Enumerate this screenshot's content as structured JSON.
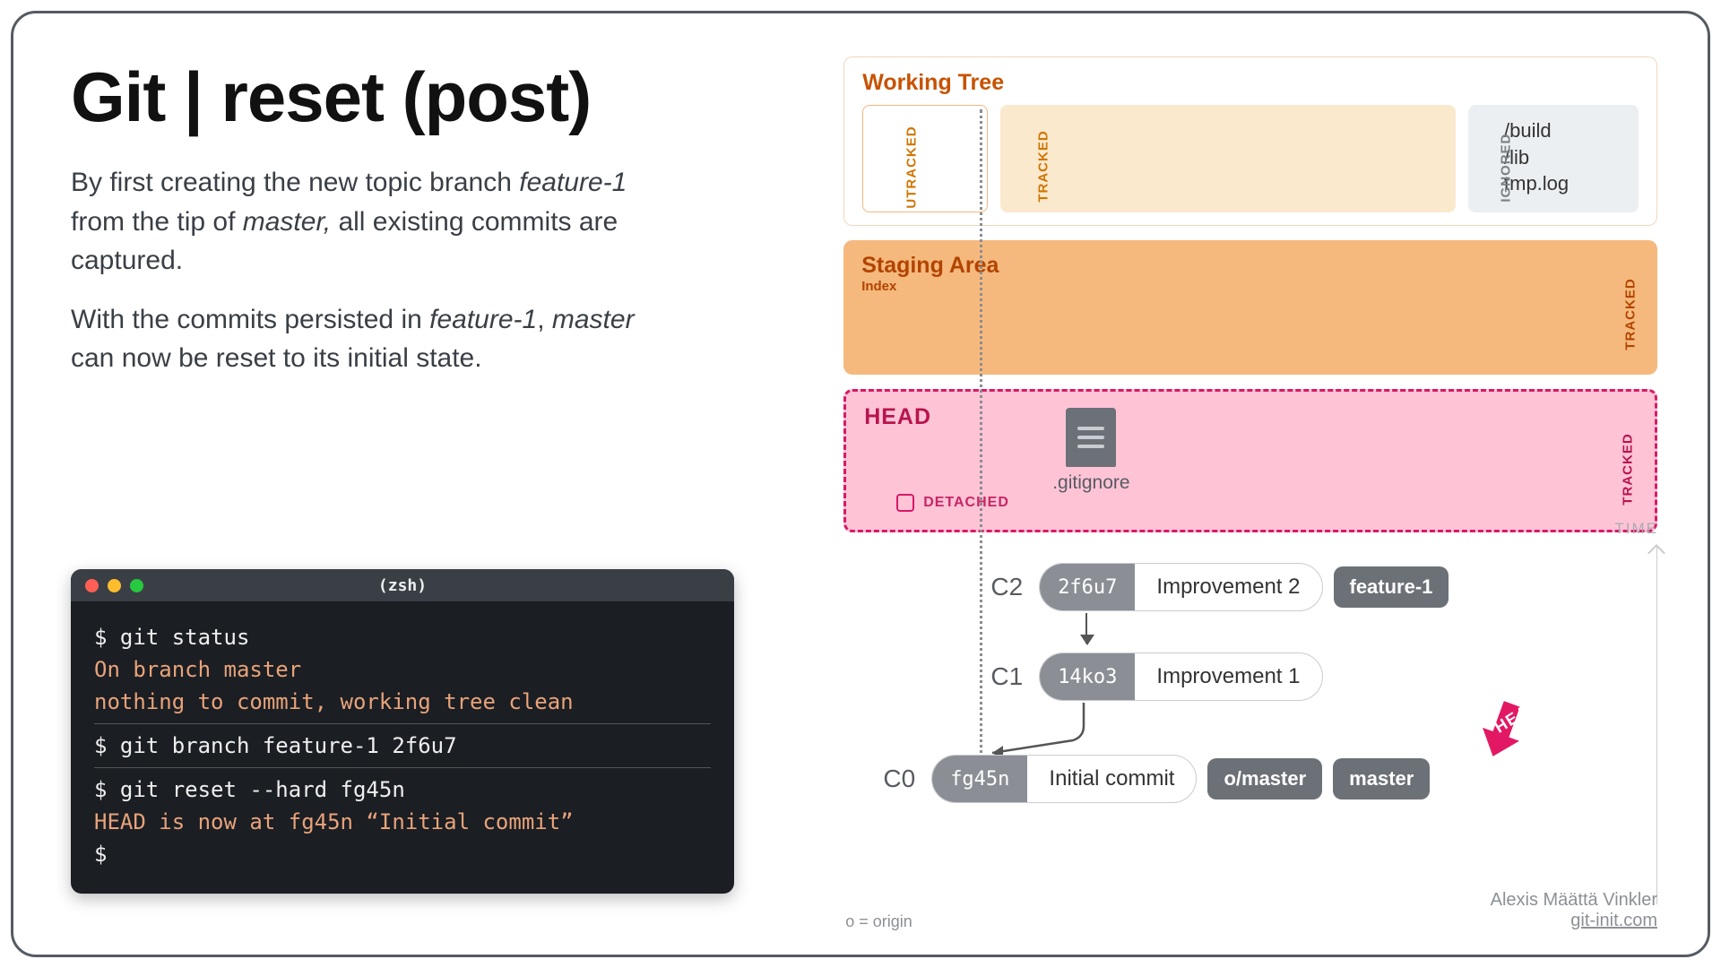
{
  "title": "Git | reset (post)",
  "description": {
    "p1_pre": "By first creating the new topic branch ",
    "p1_em1": "feature-1",
    "p1_mid": " from the tip of ",
    "p1_em2": "master,",
    "p1_post": " all existing commits are captured.",
    "p2_pre": "With the commits persisted in ",
    "p2_em1": "feature-1",
    "p2_mid": ", ",
    "p2_em2": "master",
    "p2_post": " can now be reset to its initial state."
  },
  "terminal": {
    "title": "(zsh)",
    "lines": {
      "l1": "$ git status",
      "l2": "On branch master",
      "l3": "nothing to commit, working tree clean",
      "l4": "$ git branch feature-1 2f6u7",
      "l5": "$ git reset --hard fg45n",
      "l6": "HEAD is now at fg45n “Initial commit”",
      "l7": "$"
    }
  },
  "zones": {
    "working_tree": {
      "title": "Working Tree",
      "utracked_label": "UTRACKED",
      "tracked_label": "TRACKED",
      "ignored_label": "IGNORED",
      "ignored_files": {
        "a": "/build",
        "b": "/lib",
        "c": "tmp.log"
      }
    },
    "staging": {
      "title": "Staging Area",
      "sub": "Index",
      "side": "TRACKED"
    },
    "head": {
      "title": "HEAD",
      "detached": "DETACHED",
      "side": "TRACKED",
      "file": ".gitignore"
    }
  },
  "commits": {
    "c2": {
      "id": "C2",
      "hash": "2f6u7",
      "msg": "Improvement 2",
      "tag": "feature-1"
    },
    "c1": {
      "id": "C1",
      "hash": "14ko3",
      "msg": "Improvement 1"
    },
    "c0": {
      "id": "C0",
      "hash": "fg45n",
      "msg": "Initial commit",
      "tag1": "o/master",
      "tag2": "master"
    }
  },
  "time_label": "TIME",
  "head_pointer": "HEAD",
  "origin_note": "o = origin",
  "credits": {
    "name": "Alexis Määttä Vinkler",
    "site": "git-init.com"
  }
}
